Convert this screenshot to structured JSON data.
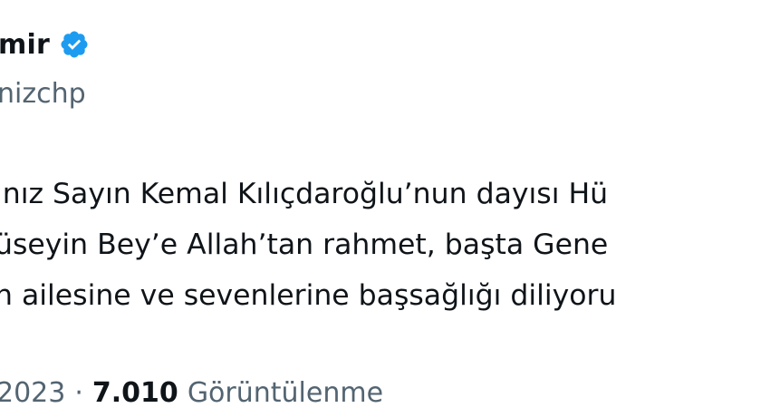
{
  "author": {
    "display_name": "mir",
    "handle": "nizchp",
    "verified": true
  },
  "tweet": {
    "lines": [
      "ınız Sayın Kemal Kılıçdaroğlu’nun dayısı Hü",
      "üseyin Bey’e Allah’tan rahmet, başta Gene",
      "n ailesine ve sevenlerine başsağlığı diliyoru"
    ]
  },
  "meta": {
    "date": "2023",
    "separator": "·",
    "views_count": "7.010",
    "views_label": "Görüntülenme"
  },
  "colors": {
    "verified_badge": "#1d9bf0",
    "text_primary": "#0f1419",
    "text_secondary": "#536471"
  },
  "icons": {
    "verified": "verified-badge-icon"
  }
}
